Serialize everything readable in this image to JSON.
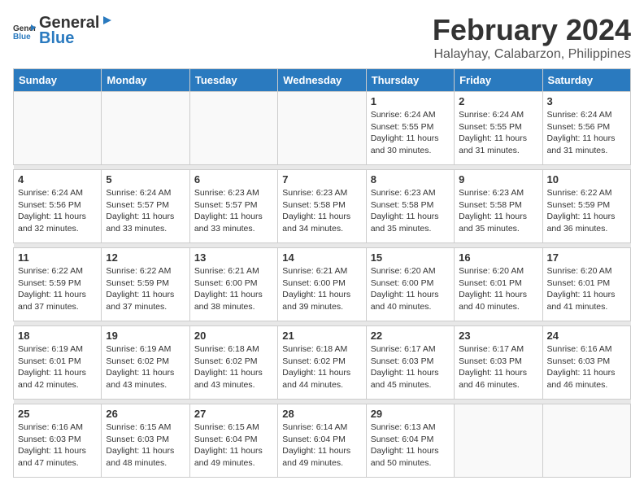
{
  "logo": {
    "general": "General",
    "blue": "Blue"
  },
  "title": "February 2024",
  "subtitle": "Halayhay, Calabarzon, Philippines",
  "headers": [
    "Sunday",
    "Monday",
    "Tuesday",
    "Wednesday",
    "Thursday",
    "Friday",
    "Saturday"
  ],
  "weeks": [
    [
      {
        "day": "",
        "text": ""
      },
      {
        "day": "",
        "text": ""
      },
      {
        "day": "",
        "text": ""
      },
      {
        "day": "",
        "text": ""
      },
      {
        "day": "1",
        "text": "Sunrise: 6:24 AM\nSunset: 5:55 PM\nDaylight: 11 hours and 30 minutes."
      },
      {
        "day": "2",
        "text": "Sunrise: 6:24 AM\nSunset: 5:55 PM\nDaylight: 11 hours and 31 minutes."
      },
      {
        "day": "3",
        "text": "Sunrise: 6:24 AM\nSunset: 5:56 PM\nDaylight: 11 hours and 31 minutes."
      }
    ],
    [
      {
        "day": "4",
        "text": "Sunrise: 6:24 AM\nSunset: 5:56 PM\nDaylight: 11 hours and 32 minutes."
      },
      {
        "day": "5",
        "text": "Sunrise: 6:24 AM\nSunset: 5:57 PM\nDaylight: 11 hours and 33 minutes."
      },
      {
        "day": "6",
        "text": "Sunrise: 6:23 AM\nSunset: 5:57 PM\nDaylight: 11 hours and 33 minutes."
      },
      {
        "day": "7",
        "text": "Sunrise: 6:23 AM\nSunset: 5:58 PM\nDaylight: 11 hours and 34 minutes."
      },
      {
        "day": "8",
        "text": "Sunrise: 6:23 AM\nSunset: 5:58 PM\nDaylight: 11 hours and 35 minutes."
      },
      {
        "day": "9",
        "text": "Sunrise: 6:23 AM\nSunset: 5:58 PM\nDaylight: 11 hours and 35 minutes."
      },
      {
        "day": "10",
        "text": "Sunrise: 6:22 AM\nSunset: 5:59 PM\nDaylight: 11 hours and 36 minutes."
      }
    ],
    [
      {
        "day": "11",
        "text": "Sunrise: 6:22 AM\nSunset: 5:59 PM\nDaylight: 11 hours and 37 minutes."
      },
      {
        "day": "12",
        "text": "Sunrise: 6:22 AM\nSunset: 5:59 PM\nDaylight: 11 hours and 37 minutes."
      },
      {
        "day": "13",
        "text": "Sunrise: 6:21 AM\nSunset: 6:00 PM\nDaylight: 11 hours and 38 minutes."
      },
      {
        "day": "14",
        "text": "Sunrise: 6:21 AM\nSunset: 6:00 PM\nDaylight: 11 hours and 39 minutes."
      },
      {
        "day": "15",
        "text": "Sunrise: 6:20 AM\nSunset: 6:00 PM\nDaylight: 11 hours and 40 minutes."
      },
      {
        "day": "16",
        "text": "Sunrise: 6:20 AM\nSunset: 6:01 PM\nDaylight: 11 hours and 40 minutes."
      },
      {
        "day": "17",
        "text": "Sunrise: 6:20 AM\nSunset: 6:01 PM\nDaylight: 11 hours and 41 minutes."
      }
    ],
    [
      {
        "day": "18",
        "text": "Sunrise: 6:19 AM\nSunset: 6:01 PM\nDaylight: 11 hours and 42 minutes."
      },
      {
        "day": "19",
        "text": "Sunrise: 6:19 AM\nSunset: 6:02 PM\nDaylight: 11 hours and 43 minutes."
      },
      {
        "day": "20",
        "text": "Sunrise: 6:18 AM\nSunset: 6:02 PM\nDaylight: 11 hours and 43 minutes."
      },
      {
        "day": "21",
        "text": "Sunrise: 6:18 AM\nSunset: 6:02 PM\nDaylight: 11 hours and 44 minutes."
      },
      {
        "day": "22",
        "text": "Sunrise: 6:17 AM\nSunset: 6:03 PM\nDaylight: 11 hours and 45 minutes."
      },
      {
        "day": "23",
        "text": "Sunrise: 6:17 AM\nSunset: 6:03 PM\nDaylight: 11 hours and 46 minutes."
      },
      {
        "day": "24",
        "text": "Sunrise: 6:16 AM\nSunset: 6:03 PM\nDaylight: 11 hours and 46 minutes."
      }
    ],
    [
      {
        "day": "25",
        "text": "Sunrise: 6:16 AM\nSunset: 6:03 PM\nDaylight: 11 hours and 47 minutes."
      },
      {
        "day": "26",
        "text": "Sunrise: 6:15 AM\nSunset: 6:03 PM\nDaylight: 11 hours and 48 minutes."
      },
      {
        "day": "27",
        "text": "Sunrise: 6:15 AM\nSunset: 6:04 PM\nDaylight: 11 hours and 49 minutes."
      },
      {
        "day": "28",
        "text": "Sunrise: 6:14 AM\nSunset: 6:04 PM\nDaylight: 11 hours and 49 minutes."
      },
      {
        "day": "29",
        "text": "Sunrise: 6:13 AM\nSunset: 6:04 PM\nDaylight: 11 hours and 50 minutes."
      },
      {
        "day": "",
        "text": ""
      },
      {
        "day": "",
        "text": ""
      }
    ]
  ]
}
